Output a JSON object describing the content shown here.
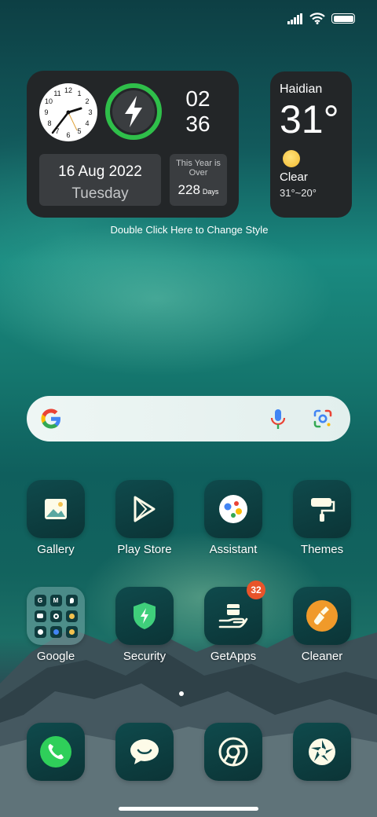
{
  "clock_widget": {
    "hour": "02",
    "minute": "36",
    "date": "16 Aug 2022",
    "weekday": "Tuesday",
    "year_caption": "This Year is Over",
    "days_remaining": "228",
    "days_unit": "Days"
  },
  "weather_widget": {
    "city": "Haidian",
    "temperature": "31°",
    "condition": "Clear",
    "range": "31°~20°",
    "icon": "sun-icon"
  },
  "hint": "Double Click Here to Change Style",
  "apps_row1": [
    {
      "label": "Gallery",
      "icon": "gallery-icon"
    },
    {
      "label": "Play Store",
      "icon": "play-store-icon"
    },
    {
      "label": "Assistant",
      "icon": "assistant-icon"
    },
    {
      "label": "Themes",
      "icon": "themes-icon"
    }
  ],
  "apps_row2": [
    {
      "label": "Google",
      "icon": "google-folder-icon"
    },
    {
      "label": "Security",
      "icon": "security-icon"
    },
    {
      "label": "GetApps",
      "icon": "getapps-icon",
      "badge": "32"
    },
    {
      "label": "Cleaner",
      "icon": "cleaner-icon"
    }
  ],
  "dock": [
    {
      "icon": "phone-icon"
    },
    {
      "icon": "messages-icon"
    },
    {
      "icon": "chrome-icon"
    },
    {
      "icon": "camera-icon"
    }
  ],
  "colors": {
    "accent_green": "#2fbf4a",
    "badge": "#e8542a",
    "widget_bg": "#232628"
  }
}
